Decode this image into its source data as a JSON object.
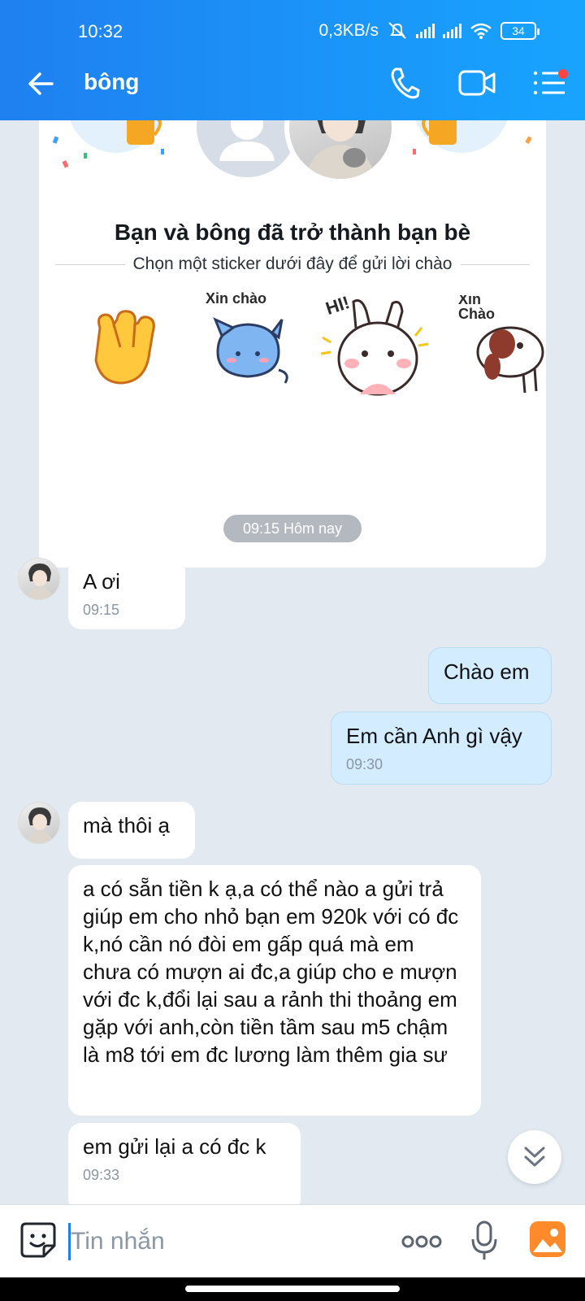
{
  "status_bar": {
    "time": "10:32",
    "network_speed": "0,3KB/s",
    "battery": "34"
  },
  "header": {
    "title": "bông",
    "back_icon": "arrow-left-icon",
    "call_icon": "phone-icon",
    "video_icon": "video-camera-icon",
    "menu_icon": "menu-list-icon"
  },
  "friend_card": {
    "title": "Bạn và bông đã trở thành bạn bè",
    "subtitle": "Chọn một sticker dưới đây để gửi lời chào",
    "stickers": [
      {
        "icon": "waving-hand-icon",
        "text": ""
      },
      {
        "icon": "blue-cat-sticker",
        "text": "Xin chào"
      },
      {
        "icon": "white-bunny-sticker",
        "text": "HI!"
      },
      {
        "icon": "dog-sticker",
        "text": "Xin Chào"
      }
    ]
  },
  "timestamp": "09:15 Hôm nay",
  "messages": [
    {
      "side": "in",
      "text": "A ơi",
      "time": "09:15"
    },
    {
      "side": "out",
      "text": "Chào em",
      "time": ""
    },
    {
      "side": "out",
      "text": "Em cần Anh gì vậy",
      "time": "09:30"
    },
    {
      "side": "in",
      "text": "mà thôi ạ",
      "time": ""
    },
    {
      "side": "in",
      "text": "a có sẵn tiền k ạ,a có thể nào a gửi trả giúp em cho nhỏ bạn em 920k với có đc k,nó cần nó đòi em gấp quá mà em chưa có mượn ai đc,a giúp cho e mượn với đc k,đổi lại sau a rảnh thi thoảng em gặp với anh,còn tiền tầm sau m5 chậm là m8 tới em đc lương làm thêm gia sư",
      "time": ""
    },
    {
      "side": "in",
      "text": "em gửi lại a có đc k",
      "time": "09:33"
    }
  ],
  "input": {
    "placeholder": "Tin nhắn"
  },
  "colors": {
    "header": "#1f80f0",
    "background": "#e2e9f1",
    "out_bubble": "#d4ecff"
  }
}
